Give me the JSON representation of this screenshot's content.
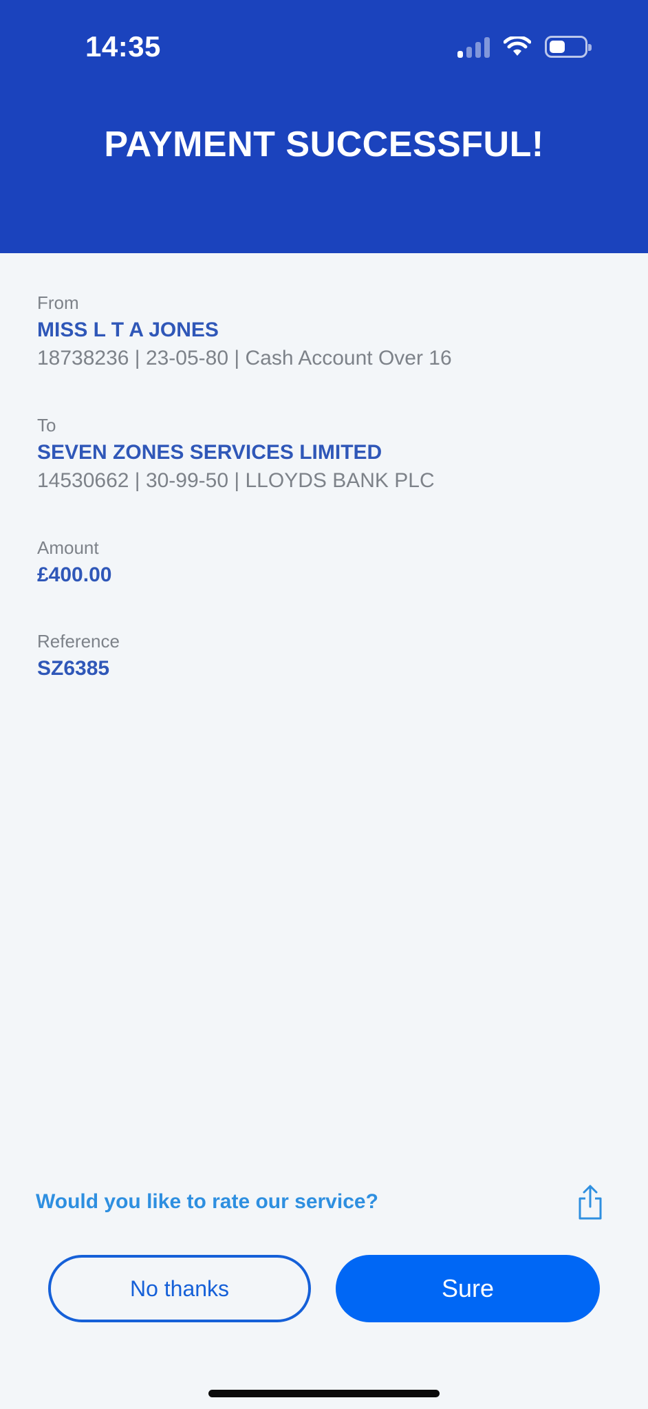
{
  "status_bar": {
    "time": "14:35"
  },
  "header": {
    "title": "PAYMENT SUCCESSFUL!"
  },
  "details": {
    "from": {
      "label": "From",
      "name": "MISS L T A JONES",
      "account_line": "18738236 | 23-05-80 | Cash Account Over 16"
    },
    "to": {
      "label": "To",
      "name": "SEVEN ZONES SERVICES LIMITED",
      "account_line": "14530662 | 30-99-50 | LLOYDS BANK PLC"
    },
    "amount": {
      "label": "Amount",
      "value": "£400.00"
    },
    "reference": {
      "label": "Reference",
      "value": "SZ6385"
    }
  },
  "rating": {
    "prompt": "Would you like to rate our service?",
    "share_icon": "share-icon",
    "decline_label": "No thanks",
    "accept_label": "Sure"
  },
  "colors": {
    "header_bg": "#1b43bd",
    "accent_text": "#2f57b8",
    "link": "#2e8fe0",
    "primary_button": "#0067f5",
    "page_bg": "#f3f6f9"
  }
}
